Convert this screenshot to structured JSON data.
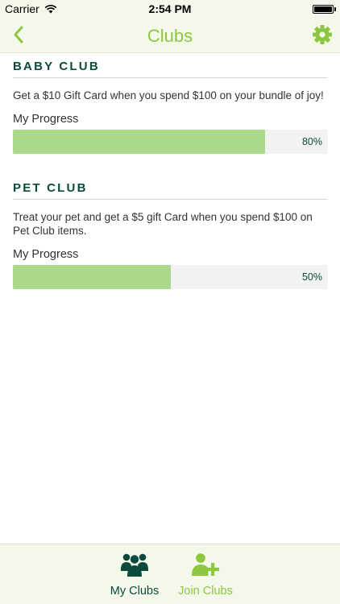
{
  "status_bar": {
    "carrier": "Carrier",
    "time": "2:54 PM"
  },
  "nav": {
    "title": "Clubs",
    "back_icon": "chevron-left-icon",
    "settings_icon": "gear-icon"
  },
  "colors": {
    "accent": "#8dc63f",
    "dark_green": "#0b4a3c",
    "progress_fill": "#abd88a",
    "progress_track": "#f2f2f2",
    "bar_bg": "#f3f8ea"
  },
  "clubs": [
    {
      "title": "BABY CLUB",
      "description": "Get a $10 Gift Card when you spend $100 on your bundle of joy!",
      "progress_label": "My Progress",
      "progress_percent": 80,
      "progress_text": "80%"
    },
    {
      "title": "PET CLUB",
      "description": "Treat your pet and get a $5 gift Card when you spend $100 on Pet Club items.",
      "progress_label": "My Progress",
      "progress_percent": 50,
      "progress_text": "50%"
    }
  ],
  "tabs": [
    {
      "label": "My Clubs",
      "icon": "group-icon",
      "active": true
    },
    {
      "label": "Join Clubs",
      "icon": "add-user-icon",
      "active": false
    }
  ]
}
